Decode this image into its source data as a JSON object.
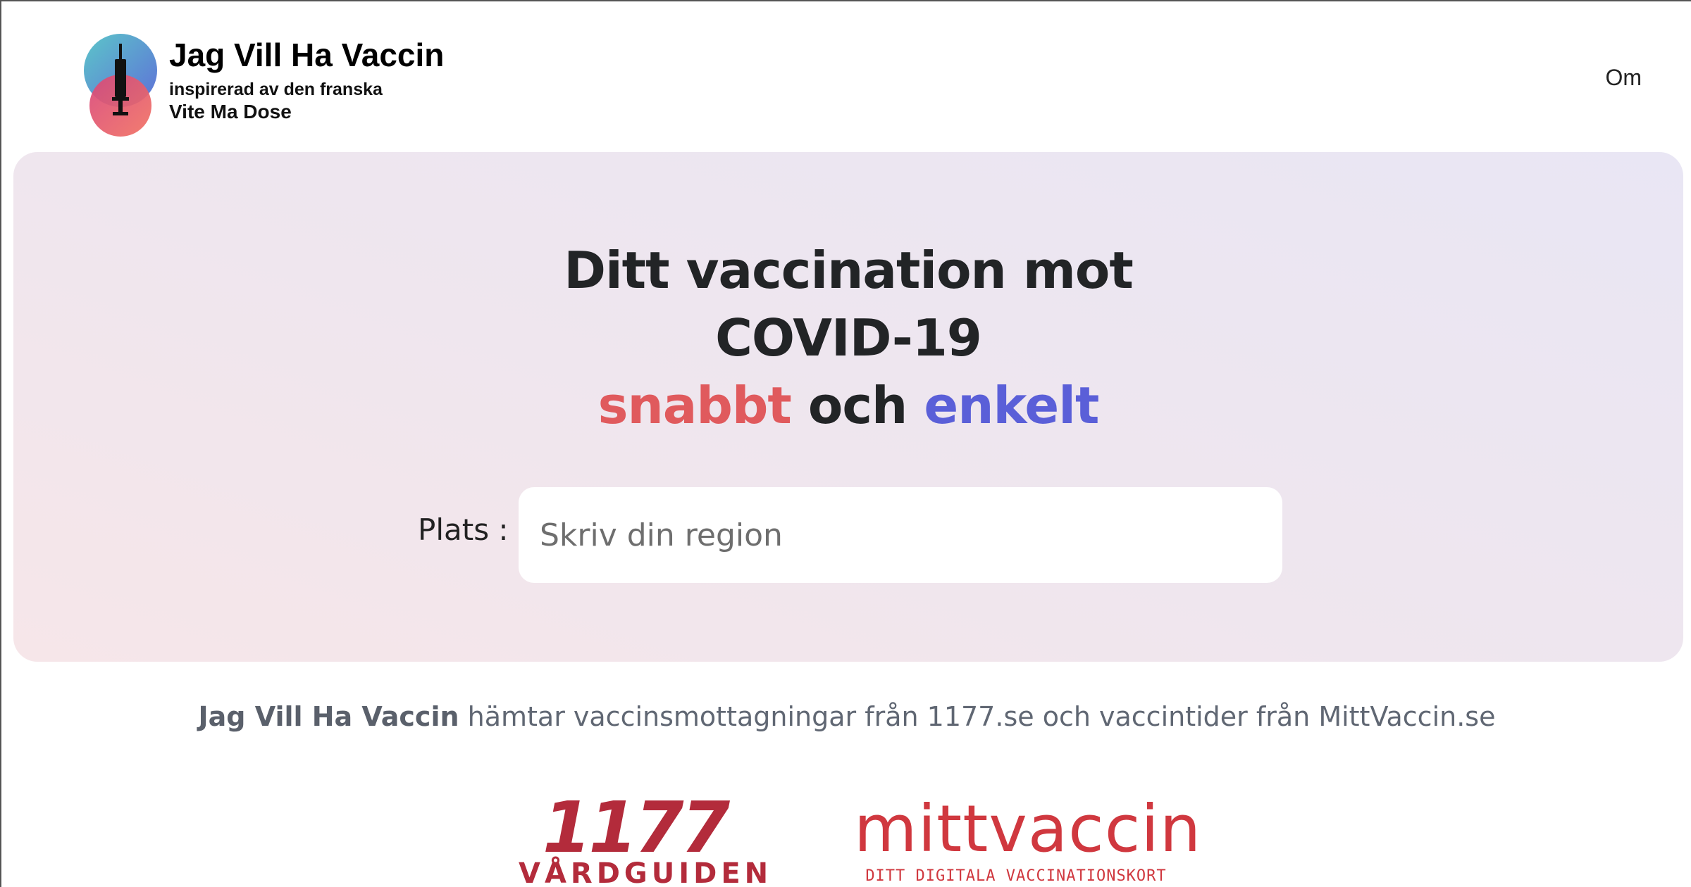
{
  "header": {
    "brand_title": "Jag Vill Ha Vaccin",
    "brand_sub_line1": "inspirerad av den franska",
    "brand_sub_line2": "Vite Ma Dose",
    "nav_om": "Om"
  },
  "hero": {
    "title_line1": "Ditt vaccination mot COVID-19",
    "word_fast": "snabbt",
    "word_and": "och",
    "word_easy": "enkelt",
    "plats_label": "Plats :",
    "region_placeholder": "Skriv din region"
  },
  "info": {
    "brand": "Jag Vill Ha Vaccin",
    "text": " hämtar vaccinsmottagningar från 1177.se och vaccintider från MittVaccin.se"
  },
  "partners": {
    "p1177_number": "1177",
    "p1177_sub": "VÅRDGUIDEN",
    "mitt_name": "mittvaccin",
    "mitt_tag": "DITT DIGITALA VACCINATIONSKORT"
  },
  "colors": {
    "accent_red": "#e05a5d",
    "accent_blue": "#5a5fd8",
    "brand_1177": "#b32b3b",
    "brand_mittvaccin": "#d0383f"
  },
  "icons": {
    "logo": "syringe-logo-icon"
  }
}
